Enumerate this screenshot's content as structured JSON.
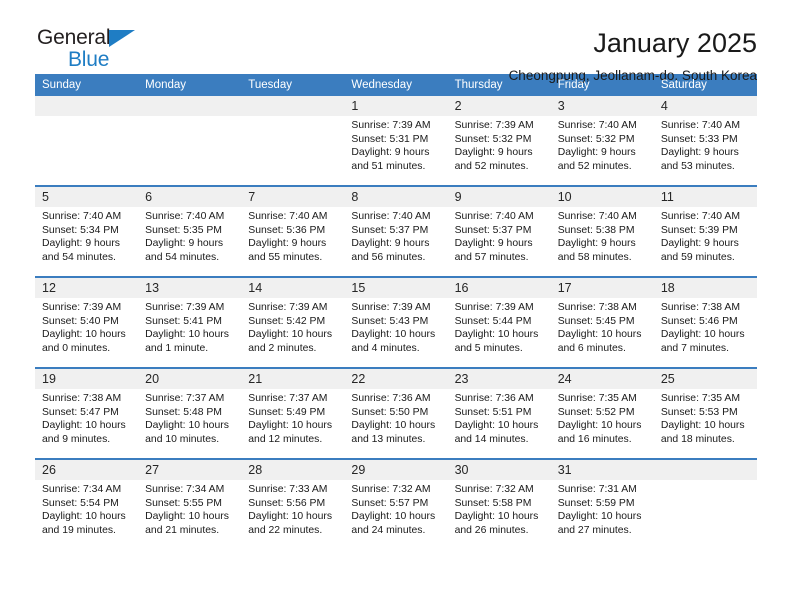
{
  "brand": {
    "name_top": "General",
    "name_bottom": "Blue",
    "triangle_icon": "brand-triangle-icon",
    "accent_color": "#1f7dc4"
  },
  "header": {
    "title": "January 2025",
    "subtitle": "Cheongpung, Jeollanam-do, South Korea"
  },
  "calendar": {
    "header_bg": "#3b7dbf",
    "daynum_bg": "#f0f0f0",
    "weekday_headers": [
      "Sunday",
      "Monday",
      "Tuesday",
      "Wednesday",
      "Thursday",
      "Friday",
      "Saturday"
    ],
    "weeks": [
      [
        {
          "day": "",
          "sunrise": "",
          "sunset": "",
          "daylight_1": "",
          "daylight_2": ""
        },
        {
          "day": "",
          "sunrise": "",
          "sunset": "",
          "daylight_1": "",
          "daylight_2": ""
        },
        {
          "day": "",
          "sunrise": "",
          "sunset": "",
          "daylight_1": "",
          "daylight_2": ""
        },
        {
          "day": "1",
          "sunrise": "Sunrise: 7:39 AM",
          "sunset": "Sunset: 5:31 PM",
          "daylight_1": "Daylight: 9 hours",
          "daylight_2": "and 51 minutes."
        },
        {
          "day": "2",
          "sunrise": "Sunrise: 7:39 AM",
          "sunset": "Sunset: 5:32 PM",
          "daylight_1": "Daylight: 9 hours",
          "daylight_2": "and 52 minutes."
        },
        {
          "day": "3",
          "sunrise": "Sunrise: 7:40 AM",
          "sunset": "Sunset: 5:32 PM",
          "daylight_1": "Daylight: 9 hours",
          "daylight_2": "and 52 minutes."
        },
        {
          "day": "4",
          "sunrise": "Sunrise: 7:40 AM",
          "sunset": "Sunset: 5:33 PM",
          "daylight_1": "Daylight: 9 hours",
          "daylight_2": "and 53 minutes."
        }
      ],
      [
        {
          "day": "5",
          "sunrise": "Sunrise: 7:40 AM",
          "sunset": "Sunset: 5:34 PM",
          "daylight_1": "Daylight: 9 hours",
          "daylight_2": "and 54 minutes."
        },
        {
          "day": "6",
          "sunrise": "Sunrise: 7:40 AM",
          "sunset": "Sunset: 5:35 PM",
          "daylight_1": "Daylight: 9 hours",
          "daylight_2": "and 54 minutes."
        },
        {
          "day": "7",
          "sunrise": "Sunrise: 7:40 AM",
          "sunset": "Sunset: 5:36 PM",
          "daylight_1": "Daylight: 9 hours",
          "daylight_2": "and 55 minutes."
        },
        {
          "day": "8",
          "sunrise": "Sunrise: 7:40 AM",
          "sunset": "Sunset: 5:37 PM",
          "daylight_1": "Daylight: 9 hours",
          "daylight_2": "and 56 minutes."
        },
        {
          "day": "9",
          "sunrise": "Sunrise: 7:40 AM",
          "sunset": "Sunset: 5:37 PM",
          "daylight_1": "Daylight: 9 hours",
          "daylight_2": "and 57 minutes."
        },
        {
          "day": "10",
          "sunrise": "Sunrise: 7:40 AM",
          "sunset": "Sunset: 5:38 PM",
          "daylight_1": "Daylight: 9 hours",
          "daylight_2": "and 58 minutes."
        },
        {
          "day": "11",
          "sunrise": "Sunrise: 7:40 AM",
          "sunset": "Sunset: 5:39 PM",
          "daylight_1": "Daylight: 9 hours",
          "daylight_2": "and 59 minutes."
        }
      ],
      [
        {
          "day": "12",
          "sunrise": "Sunrise: 7:39 AM",
          "sunset": "Sunset: 5:40 PM",
          "daylight_1": "Daylight: 10 hours",
          "daylight_2": "and 0 minutes."
        },
        {
          "day": "13",
          "sunrise": "Sunrise: 7:39 AM",
          "sunset": "Sunset: 5:41 PM",
          "daylight_1": "Daylight: 10 hours",
          "daylight_2": "and 1 minute."
        },
        {
          "day": "14",
          "sunrise": "Sunrise: 7:39 AM",
          "sunset": "Sunset: 5:42 PM",
          "daylight_1": "Daylight: 10 hours",
          "daylight_2": "and 2 minutes."
        },
        {
          "day": "15",
          "sunrise": "Sunrise: 7:39 AM",
          "sunset": "Sunset: 5:43 PM",
          "daylight_1": "Daylight: 10 hours",
          "daylight_2": "and 4 minutes."
        },
        {
          "day": "16",
          "sunrise": "Sunrise: 7:39 AM",
          "sunset": "Sunset: 5:44 PM",
          "daylight_1": "Daylight: 10 hours",
          "daylight_2": "and 5 minutes."
        },
        {
          "day": "17",
          "sunrise": "Sunrise: 7:38 AM",
          "sunset": "Sunset: 5:45 PM",
          "daylight_1": "Daylight: 10 hours",
          "daylight_2": "and 6 minutes."
        },
        {
          "day": "18",
          "sunrise": "Sunrise: 7:38 AM",
          "sunset": "Sunset: 5:46 PM",
          "daylight_1": "Daylight: 10 hours",
          "daylight_2": "and 7 minutes."
        }
      ],
      [
        {
          "day": "19",
          "sunrise": "Sunrise: 7:38 AM",
          "sunset": "Sunset: 5:47 PM",
          "daylight_1": "Daylight: 10 hours",
          "daylight_2": "and 9 minutes."
        },
        {
          "day": "20",
          "sunrise": "Sunrise: 7:37 AM",
          "sunset": "Sunset: 5:48 PM",
          "daylight_1": "Daylight: 10 hours",
          "daylight_2": "and 10 minutes."
        },
        {
          "day": "21",
          "sunrise": "Sunrise: 7:37 AM",
          "sunset": "Sunset: 5:49 PM",
          "daylight_1": "Daylight: 10 hours",
          "daylight_2": "and 12 minutes."
        },
        {
          "day": "22",
          "sunrise": "Sunrise: 7:36 AM",
          "sunset": "Sunset: 5:50 PM",
          "daylight_1": "Daylight: 10 hours",
          "daylight_2": "and 13 minutes."
        },
        {
          "day": "23",
          "sunrise": "Sunrise: 7:36 AM",
          "sunset": "Sunset: 5:51 PM",
          "daylight_1": "Daylight: 10 hours",
          "daylight_2": "and 14 minutes."
        },
        {
          "day": "24",
          "sunrise": "Sunrise: 7:35 AM",
          "sunset": "Sunset: 5:52 PM",
          "daylight_1": "Daylight: 10 hours",
          "daylight_2": "and 16 minutes."
        },
        {
          "day": "25",
          "sunrise": "Sunrise: 7:35 AM",
          "sunset": "Sunset: 5:53 PM",
          "daylight_1": "Daylight: 10 hours",
          "daylight_2": "and 18 minutes."
        }
      ],
      [
        {
          "day": "26",
          "sunrise": "Sunrise: 7:34 AM",
          "sunset": "Sunset: 5:54 PM",
          "daylight_1": "Daylight: 10 hours",
          "daylight_2": "and 19 minutes."
        },
        {
          "day": "27",
          "sunrise": "Sunrise: 7:34 AM",
          "sunset": "Sunset: 5:55 PM",
          "daylight_1": "Daylight: 10 hours",
          "daylight_2": "and 21 minutes."
        },
        {
          "day": "28",
          "sunrise": "Sunrise: 7:33 AM",
          "sunset": "Sunset: 5:56 PM",
          "daylight_1": "Daylight: 10 hours",
          "daylight_2": "and 22 minutes."
        },
        {
          "day": "29",
          "sunrise": "Sunrise: 7:32 AM",
          "sunset": "Sunset: 5:57 PM",
          "daylight_1": "Daylight: 10 hours",
          "daylight_2": "and 24 minutes."
        },
        {
          "day": "30",
          "sunrise": "Sunrise: 7:32 AM",
          "sunset": "Sunset: 5:58 PM",
          "daylight_1": "Daylight: 10 hours",
          "daylight_2": "and 26 minutes."
        },
        {
          "day": "31",
          "sunrise": "Sunrise: 7:31 AM",
          "sunset": "Sunset: 5:59 PM",
          "daylight_1": "Daylight: 10 hours",
          "daylight_2": "and 27 minutes."
        },
        {
          "day": "",
          "sunrise": "",
          "sunset": "",
          "daylight_1": "",
          "daylight_2": ""
        }
      ]
    ]
  }
}
